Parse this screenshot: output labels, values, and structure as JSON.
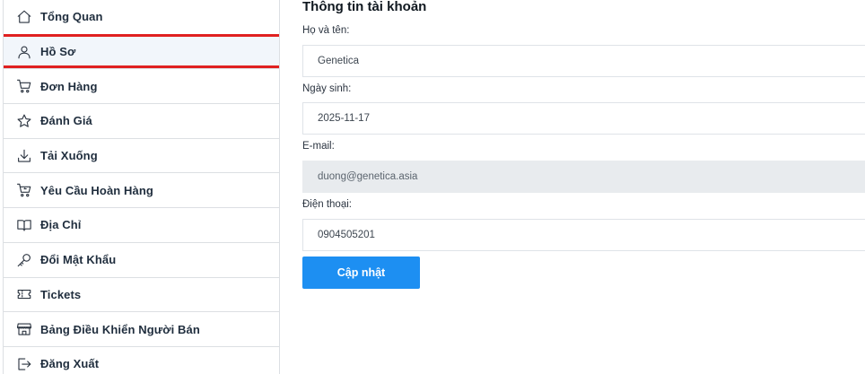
{
  "sidebar": {
    "items": [
      {
        "label": "Tổng Quan",
        "icon": "home-icon"
      },
      {
        "label": "Hồ Sơ",
        "icon": "user-icon",
        "active": true
      },
      {
        "label": "Đơn Hàng",
        "icon": "cart-icon"
      },
      {
        "label": "Đánh Giá",
        "icon": "star-icon"
      },
      {
        "label": "Tải Xuống",
        "icon": "download-icon"
      },
      {
        "label": "Yêu Cầu Hoàn Hàng",
        "icon": "cart-return-icon"
      },
      {
        "label": "Địa Chỉ",
        "icon": "book-icon"
      },
      {
        "label": "Đổi Mật Khẩu",
        "icon": "key-icon"
      },
      {
        "label": "Tickets",
        "icon": "ticket-icon"
      },
      {
        "label": "Bảng Điều Khiển Người Bán",
        "icon": "store-icon"
      },
      {
        "label": "Đăng Xuất",
        "icon": "logout-icon"
      }
    ]
  },
  "form": {
    "title": "Thông tin tài khoản",
    "fullname": {
      "label": "Họ và tên:",
      "value": "Genetica"
    },
    "birthday": {
      "label": "Ngày sinh:",
      "value": "2025-11-17"
    },
    "email": {
      "label": "E-mail:",
      "value": "duong@genetica.asia"
    },
    "phone": {
      "label": "Điện thoại:",
      "value": "0904505201"
    },
    "submit_label": "Cập nhật"
  },
  "colors": {
    "accent": "#1d8ff2",
    "highlight_border": "#e02020",
    "active_bg": "#f2f6fb",
    "disabled_bg": "#e8ebee"
  }
}
